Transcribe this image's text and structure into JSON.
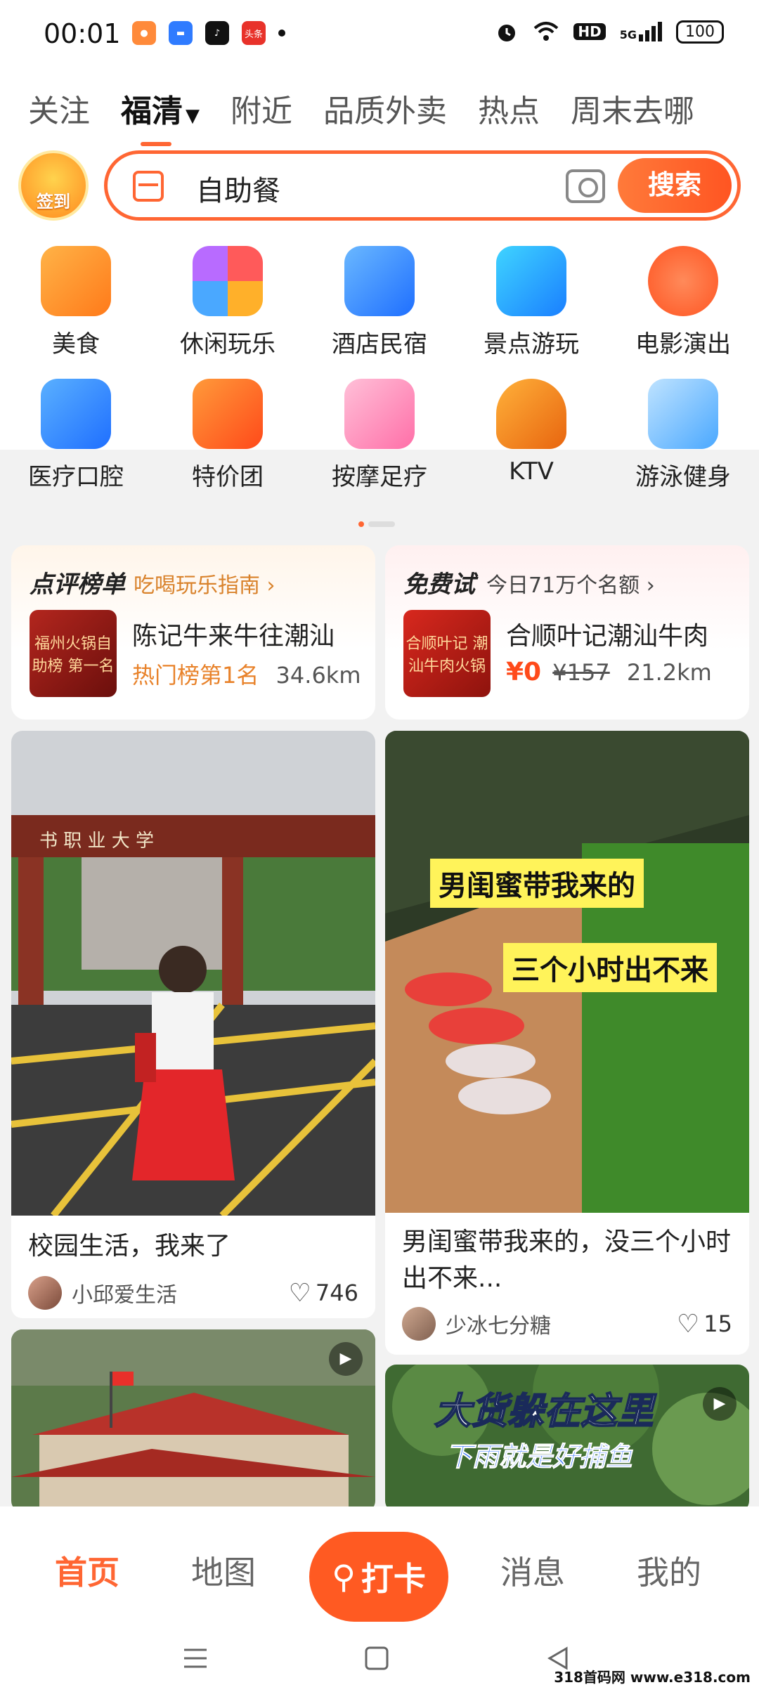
{
  "status_bar": {
    "time": "00:01",
    "apps": [
      "game-icon",
      "message-icon",
      "tiktok-icon",
      "toutiao-icon"
    ],
    "toutiao_text": "头条",
    "network": "5G",
    "hd": "HD",
    "battery": "100"
  },
  "tabs": [
    {
      "label": "关注"
    },
    {
      "label": "福清",
      "active": true
    },
    {
      "label": "附近"
    },
    {
      "label": "品质外卖"
    },
    {
      "label": "热点"
    },
    {
      "label": "周末去哪"
    }
  ],
  "checkin": {
    "label": "签到"
  },
  "search": {
    "value": "自助餐",
    "button": "搜索"
  },
  "categories": [
    {
      "label": "美食",
      "icon": "roast-chicken-icon",
      "color": "#ff8a2a"
    },
    {
      "label": "休闲玩乐",
      "icon": "leisure-icon",
      "color": "#ff6a5a"
    },
    {
      "label": "酒店民宿",
      "icon": "hotel-icon",
      "color": "#2f8cff"
    },
    {
      "label": "景点游玩",
      "icon": "palm-tree-icon",
      "color": "#1aa7ff"
    },
    {
      "label": "电影演出",
      "icon": "cat-face-icon",
      "color": "#ff6a3a"
    },
    {
      "label": "医疗口腔",
      "icon": "medical-icon",
      "color": "#2f8cff"
    },
    {
      "label": "特价团",
      "icon": "discount-icon",
      "color": "#ff5a1a"
    },
    {
      "label": "按摩足疗",
      "icon": "massage-icon",
      "color": "#ff7fb0"
    },
    {
      "label": "KTV",
      "icon": "microphone-icon",
      "color": "#ff8a1a"
    },
    {
      "label": "游泳健身",
      "icon": "fitness-icon",
      "color": "#4aa8ff"
    }
  ],
  "rank_card": {
    "title": "点评榜单",
    "subtitle": "吃喝玩乐指南",
    "thumb_text": "福州火锅自助榜 第一名",
    "name": "陈记牛来牛往潮汕",
    "rank": "热门榜第1名",
    "distance": "34.6km"
  },
  "trial_card": {
    "title": "免费试",
    "subtitle": "今日71万个名额",
    "thumb_text": "合顺叶记 潮汕牛肉火锅",
    "name": "合顺叶记潮汕牛肉",
    "price": "¥0",
    "original_price": "¥157",
    "distance": "21.2km"
  },
  "feed": [
    {
      "title": "校园生活，我来了",
      "author": "小邱爱生活",
      "likes": "746",
      "gate_text": "书 职 业 大 学"
    },
    {
      "title": "男闺蜜带我来的，没三个小时出不来...",
      "author": "少冰七分糖",
      "likes": "15",
      "overlay_1": "男闺蜜带我来的",
      "overlay_2": "三个小时出不来"
    },
    {
      "title": "",
      "author": "",
      "likes": ""
    },
    {
      "title": "",
      "author": "",
      "likes": "",
      "overlay_1": "大货躲在这里",
      "overlay_2": "下雨就是好捕鱼"
    }
  ],
  "bottom_nav": {
    "home": "首页",
    "map": "地图",
    "checkin": "打卡",
    "messages": "消息",
    "me": "我的"
  },
  "watermark": "318首码网 www.e318.com",
  "colors": {
    "accent": "#ff6633",
    "background": "#f2f2f2"
  }
}
